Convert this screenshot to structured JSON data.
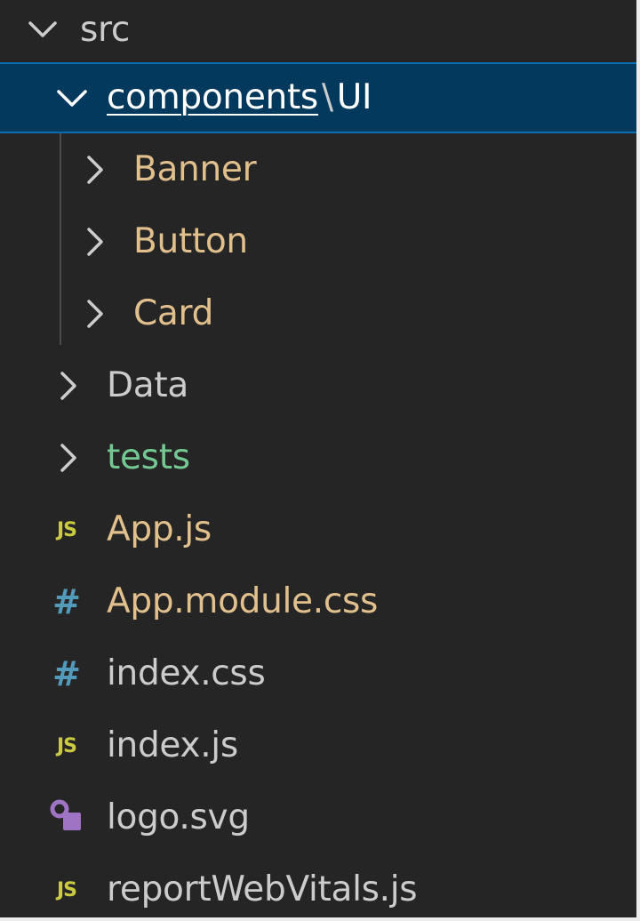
{
  "tree": {
    "root": {
      "label": "src",
      "expanded": true
    },
    "selected_folder": {
      "label_primary": "components",
      "separator": "\\",
      "label_secondary": "UI",
      "expanded": true
    },
    "subfolders": [
      {
        "label": "Banner",
        "expanded": false
      },
      {
        "label": "Button",
        "expanded": false
      },
      {
        "label": "Card",
        "expanded": false
      }
    ],
    "folders": [
      {
        "label": "Data",
        "expanded": false,
        "color": "#cccccc"
      },
      {
        "label": "tests",
        "expanded": false,
        "color": "#73c991"
      }
    ],
    "files": [
      {
        "label": "App.js",
        "icon": "js-file-icon",
        "icon_text": "JS"
      },
      {
        "label": "App.module.css",
        "icon": "css-file-icon",
        "icon_text": "#"
      },
      {
        "label": "index.css",
        "icon": "css-file-icon",
        "icon_text": "#"
      },
      {
        "label": "index.js",
        "icon": "js-file-icon",
        "icon_text": "JS"
      },
      {
        "label": "logo.svg",
        "icon": "svg-file-icon",
        "icon_text": ""
      },
      {
        "label": "reportWebVitals.js",
        "icon": "js-file-icon",
        "icon_text": "JS"
      }
    ]
  },
  "colors": {
    "background": "#252526",
    "selection": "#04395e",
    "selection_border": "#0d6cb0",
    "modified": "#e2c08d",
    "untracked": "#73c991",
    "js_icon": "#cbcb41",
    "css_icon": "#519aba",
    "svg_icon": "#a074c4"
  }
}
